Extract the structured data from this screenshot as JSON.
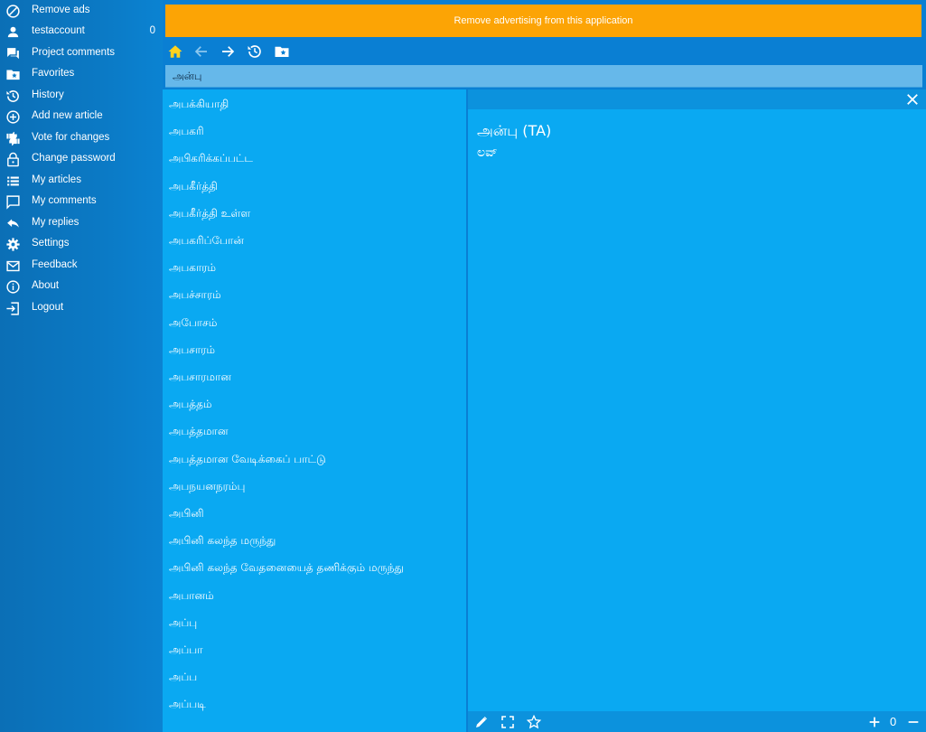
{
  "sidebar": {
    "items": [
      {
        "label": "Remove ads",
        "icon": "block-icon"
      },
      {
        "label": "testaccount",
        "icon": "person-icon",
        "count": "0"
      },
      {
        "label": "Project comments",
        "icon": "forum-icon"
      },
      {
        "label": "Favorites",
        "icon": "folder-star-icon"
      },
      {
        "label": "History",
        "icon": "history-icon"
      },
      {
        "label": "Add new article",
        "icon": "add-circle-icon"
      },
      {
        "label": "Vote for changes",
        "icon": "thumbs-icon"
      },
      {
        "label": "Change password",
        "icon": "lock-icon"
      },
      {
        "label": "My articles",
        "icon": "list-icon"
      },
      {
        "label": "My comments",
        "icon": "comment-icon"
      },
      {
        "label": "My replies",
        "icon": "reply-icon"
      },
      {
        "label": "Settings",
        "icon": "gear-icon"
      },
      {
        "label": "Feedback",
        "icon": "mail-icon"
      },
      {
        "label": "About",
        "icon": "info-icon"
      },
      {
        "label": "Logout",
        "icon": "logout-icon"
      }
    ]
  },
  "ad_banner": {
    "text": "Remove advertising from this application",
    "color": "#fca405"
  },
  "toolbar": {
    "buttons": [
      "home-icon",
      "back-arrow-icon",
      "forward-arrow-icon",
      "history-icon",
      "folder-star-icon"
    ]
  },
  "search": {
    "value": "அன்பு"
  },
  "word_list": [
    "அபக்கியாதி",
    "அபகரி",
    "அபிகரிக்கப்பட்ட",
    "அபகீர்த்தி",
    "அபகீர்த்தி உள்ள",
    "அபகரிப்போன்",
    "அபகாரம்",
    "அபச்சாரம்",
    "அபோசம்",
    "அபசாரம்",
    "அபசாரமான",
    "அபத்தம்",
    "அபத்தமான",
    "அபத்தமான வேடிக்கைப் பாட்டு",
    "அபநயனநரம்பு",
    "அபினி",
    "அபினி கலந்த மருந்து",
    "அபினி கலந்த வேதனையைத் தணிக்கும் மருந்து",
    "அபானம்",
    "அப்பு",
    "அப்பா",
    "அப்ப",
    "அப்படி"
  ],
  "detail": {
    "title": "அன்பு (TA)",
    "translation": "ಲವ್",
    "vote_count": "0"
  },
  "colors": {
    "sidebar_bg": "#0b79c4",
    "panel_bg": "#0aa9f2",
    "bar_bg": "#0c92dd",
    "home_icon": "#ffd21f"
  }
}
